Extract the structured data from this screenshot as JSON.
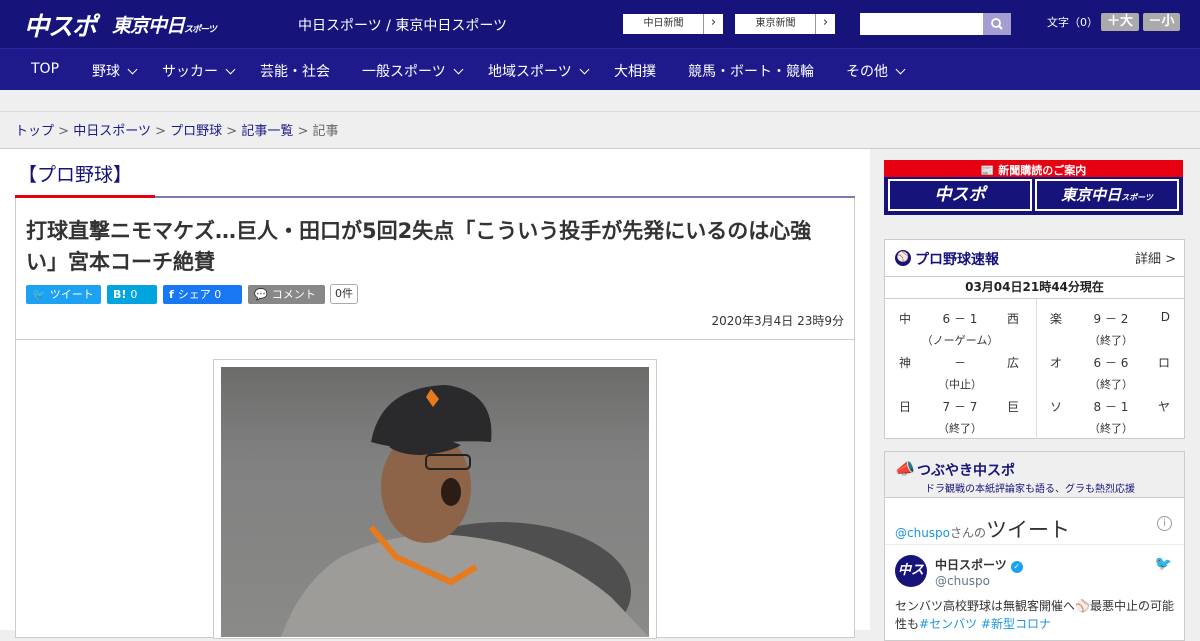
{
  "header": {
    "logo_chuspo": "中スポ",
    "logo_tokyo": "東京中日",
    "logo_tokyo_small": "スポーツ",
    "site_title": "中日スポーツ / 東京中日スポーツ",
    "paper_links": [
      "中日新聞",
      "東京新聞"
    ],
    "search_placeholder": "",
    "font_label": "文字（0）",
    "font_larger": "＋大",
    "font_smaller": "－小"
  },
  "nav": {
    "items": [
      {
        "label": "TOP",
        "dropdown": false
      },
      {
        "label": "野球",
        "dropdown": true
      },
      {
        "label": "サッカー",
        "dropdown": true
      },
      {
        "label": "芸能・社会",
        "dropdown": false
      },
      {
        "label": "一般スポーツ",
        "dropdown": true
      },
      {
        "label": "地域スポーツ",
        "dropdown": true
      },
      {
        "label": "大相撲",
        "dropdown": false
      },
      {
        "label": "競馬・ボート・競輪",
        "dropdown": false
      },
      {
        "label": "その他",
        "dropdown": true
      }
    ]
  },
  "breadcrumb": {
    "items": [
      "トップ",
      "中日スポーツ",
      "プロ野球",
      "記事一覧"
    ],
    "current": "記事",
    "separator": ">"
  },
  "article": {
    "category": "【プロ野球】",
    "headline": "打球直撃ニモマケズ…巨人・田口が5回2失点「こういう投手が先発にいるのは心強い」宮本コーチ絶賛",
    "share": {
      "tweet": "ツイート",
      "hatena": "B!",
      "hatena_count": "0",
      "facebook": "シェア",
      "facebook_count": "0",
      "comment": "コメント",
      "comment_count": "0件"
    },
    "date": "2020年3月4日 23時9分"
  },
  "sidebar": {
    "promo": {
      "title": "新聞購読のご案内",
      "logo_chuspo": "中スポ",
      "logo_tokyo": "東京中日",
      "logo_tokyo_small": "スポーツ"
    },
    "scores": {
      "title": "プロ野球速報",
      "more": "詳細 >",
      "updated": "03月04日21時44分現在",
      "games": [
        {
          "home": "中",
          "score": "6 － 1",
          "away": "西",
          "status": "（ノーゲーム）"
        },
        {
          "home": "楽",
          "score": "9 － 2",
          "away": "D",
          "status": "（終了）"
        },
        {
          "home": "神",
          "score": "－",
          "away": "広",
          "status": "（中止）"
        },
        {
          "home": "オ",
          "score": "6 － 6",
          "away": "ロ",
          "status": "（終了）"
        },
        {
          "home": "日",
          "score": "7 － 7",
          "away": "巨",
          "status": "（終了）"
        },
        {
          "home": "ソ",
          "score": "8 － 1",
          "away": "ヤ",
          "status": "（終了）"
        }
      ]
    },
    "tweets": {
      "title": "つぶやき中スポ",
      "subtitle": "ドラ観戦の本紙評論家も語る、グラも熱烈応援",
      "handle": "@chuspo",
      "handle_suffix": "さんの",
      "tweet_word": "ツイート",
      "info": "i",
      "avatar_text": "中スポ",
      "name": "中日スポーツ",
      "username": "@chuspo",
      "text_before": "センバツ高校野球は無観客開催へ",
      "text_emoji": "⚾",
      "text_after": "最悪中止の可能性も",
      "hashtags": [
        "#センバツ",
        "#新型コロナ"
      ]
    }
  },
  "colors": {
    "brand_navy": "#16137a",
    "nav_blue": "#1e1a8c",
    "accent_red": "#e60012",
    "twitter": "#1da1f2",
    "hatena": "#00a4de",
    "facebook": "#1877f2",
    "comment_gray": "#888888"
  },
  "icons": {
    "search": "search-icon",
    "baseball": "baseball-icon",
    "twitter": "twitter-bird-icon",
    "facebook": "facebook-icon",
    "comment": "comment-icon",
    "newspaper": "newspaper-icon",
    "verified": "verified-badge-icon",
    "info": "info-icon"
  }
}
